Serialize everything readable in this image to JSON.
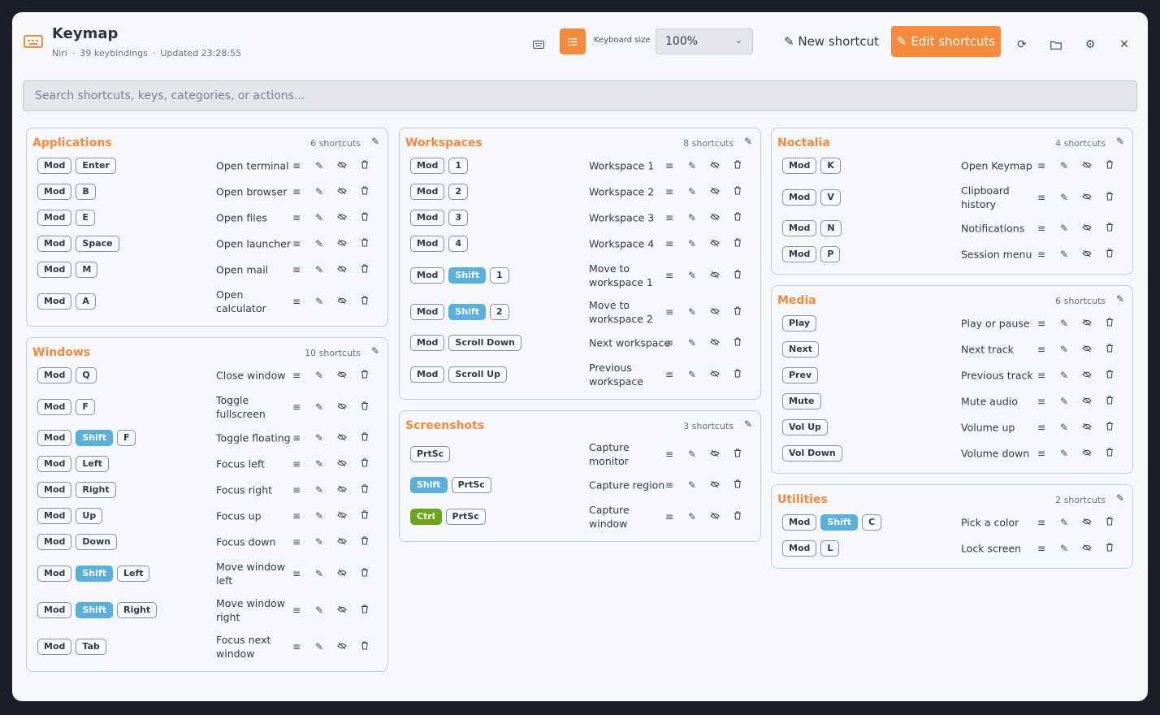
{
  "header": {
    "title": "Keymap",
    "subtitle_parts": [
      "Niri",
      "39 keybindings",
      "Updated 23:28:55"
    ],
    "keyboard_size_label": "Keyboard size",
    "keyboard_size_value": "100%",
    "new_shortcut_label": "New shortcut",
    "edit_shortcuts_label": "Edit shortcuts",
    "icons": [
      "keyboard-icon",
      "list-icon",
      "refresh-icon",
      "folder-icon",
      "settings-icon",
      "close-icon"
    ]
  },
  "search": {
    "placeholder": "Search shortcuts, keys, categories, or actions..."
  },
  "colors": {
    "accent": "#f58a3b",
    "shift": "#5ab0dc",
    "ctrl": "#6aa51c"
  },
  "columns": [
    [
      {
        "title": "Applications",
        "count": "6 shortcuts",
        "shortcuts": [
          {
            "keys": [
              "Mod",
              "Enter"
            ],
            "action": "Open terminal"
          },
          {
            "keys": [
              "Mod",
              "B"
            ],
            "action": "Open browser"
          },
          {
            "keys": [
              "Mod",
              "E"
            ],
            "action": "Open files"
          },
          {
            "keys": [
              "Mod",
              "Space"
            ],
            "action": "Open launcher"
          },
          {
            "keys": [
              "Mod",
              "M"
            ],
            "action": "Open mail"
          },
          {
            "keys": [
              "Mod",
              "A"
            ],
            "action": "Open calculator"
          }
        ]
      },
      {
        "title": "Windows",
        "count": "10 shortcuts",
        "shortcuts": [
          {
            "keys": [
              "Mod",
              "Q"
            ],
            "action": "Close window"
          },
          {
            "keys": [
              "Mod",
              "F"
            ],
            "action": "Toggle fullscreen"
          },
          {
            "keys": [
              "Mod",
              "Shift",
              "F"
            ],
            "action": "Toggle floating"
          },
          {
            "keys": [
              "Mod",
              "Left"
            ],
            "action": "Focus left"
          },
          {
            "keys": [
              "Mod",
              "Right"
            ],
            "action": "Focus right"
          },
          {
            "keys": [
              "Mod",
              "Up"
            ],
            "action": "Focus up"
          },
          {
            "keys": [
              "Mod",
              "Down"
            ],
            "action": "Focus down"
          },
          {
            "keys": [
              "Mod",
              "Shift",
              "Left"
            ],
            "action": "Move window left"
          },
          {
            "keys": [
              "Mod",
              "Shift",
              "Right"
            ],
            "action": "Move window right"
          },
          {
            "keys": [
              "Mod",
              "Tab"
            ],
            "action": "Focus next window"
          }
        ]
      }
    ],
    [
      {
        "title": "Workspaces",
        "count": "8 shortcuts",
        "shortcuts": [
          {
            "keys": [
              "Mod",
              "1"
            ],
            "action": "Workspace 1"
          },
          {
            "keys": [
              "Mod",
              "2"
            ],
            "action": "Workspace 2"
          },
          {
            "keys": [
              "Mod",
              "3"
            ],
            "action": "Workspace 3"
          },
          {
            "keys": [
              "Mod",
              "4"
            ],
            "action": "Workspace 4"
          },
          {
            "keys": [
              "Mod",
              "Shift",
              "1"
            ],
            "action": "Move to workspace 1"
          },
          {
            "keys": [
              "Mod",
              "Shift",
              "2"
            ],
            "action": "Move to workspace 2"
          },
          {
            "keys": [
              "Mod",
              "Scroll Down"
            ],
            "action": "Next workspace"
          },
          {
            "keys": [
              "Mod",
              "Scroll Up"
            ],
            "action": "Previous workspace"
          }
        ]
      },
      {
        "title": "Screenshots",
        "count": "3 shortcuts",
        "shortcuts": [
          {
            "keys": [
              "PrtSc"
            ],
            "action": "Capture monitor"
          },
          {
            "keys": [
              "Shift",
              "PrtSc"
            ],
            "action": "Capture region"
          },
          {
            "keys": [
              "Ctrl",
              "PrtSc"
            ],
            "action": "Capture window"
          }
        ]
      }
    ],
    [
      {
        "title": "Noctalia",
        "count": "4 shortcuts",
        "shortcuts": [
          {
            "keys": [
              "Mod",
              "K"
            ],
            "action": "Open Keymap"
          },
          {
            "keys": [
              "Mod",
              "V"
            ],
            "action": "Clipboard history"
          },
          {
            "keys": [
              "Mod",
              "N"
            ],
            "action": "Notifications"
          },
          {
            "keys": [
              "Mod",
              "P"
            ],
            "action": "Session menu"
          }
        ]
      },
      {
        "title": "Media",
        "count": "6 shortcuts",
        "shortcuts": [
          {
            "keys": [
              "Play"
            ],
            "action": "Play or pause"
          },
          {
            "keys": [
              "Next"
            ],
            "action": "Next track"
          },
          {
            "keys": [
              "Prev"
            ],
            "action": "Previous track"
          },
          {
            "keys": [
              "Mute"
            ],
            "action": "Mute audio"
          },
          {
            "keys": [
              "Vol Up"
            ],
            "action": "Volume up"
          },
          {
            "keys": [
              "Vol Down"
            ],
            "action": "Volume down"
          }
        ]
      },
      {
        "title": "Utilities",
        "count": "2 shortcuts",
        "shortcuts": [
          {
            "keys": [
              "Mod",
              "Shift",
              "C"
            ],
            "action": "Pick a color"
          },
          {
            "keys": [
              "Mod",
              "L"
            ],
            "action": "Lock screen"
          }
        ]
      }
    ]
  ]
}
